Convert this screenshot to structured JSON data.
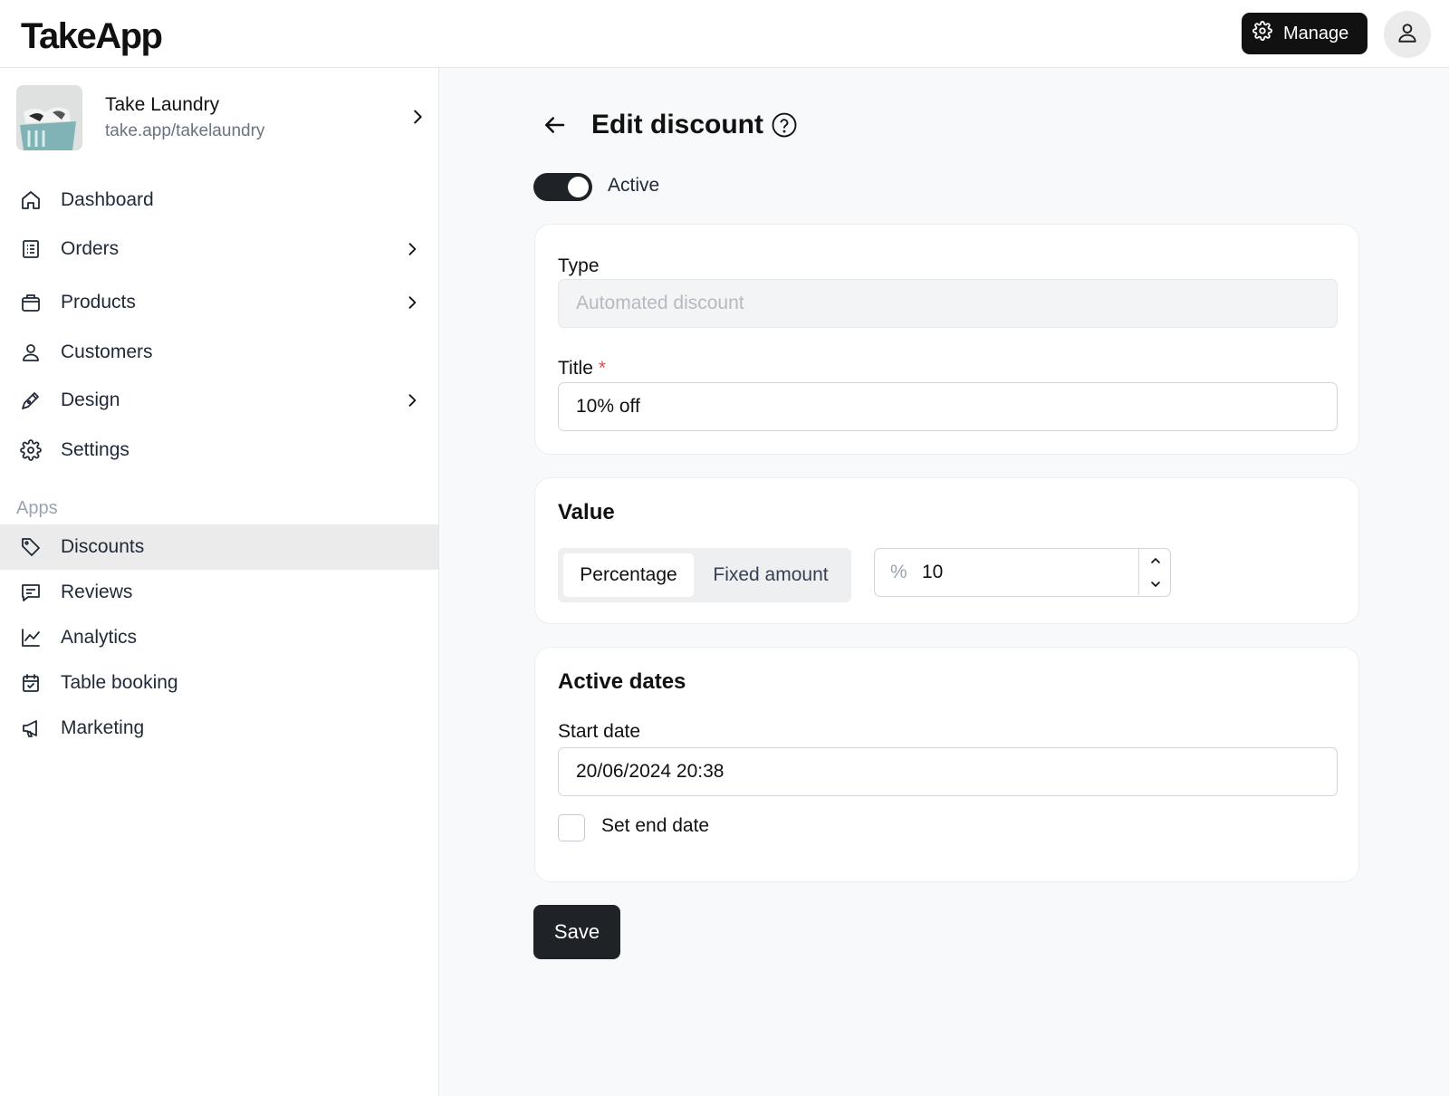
{
  "header": {
    "logo": "TakeApp",
    "manage_label": "Manage"
  },
  "store": {
    "name": "Take Laundry",
    "url": "take.app/takelaundry"
  },
  "sidebar": {
    "items": [
      {
        "label": "Dashboard"
      },
      {
        "label": "Orders"
      },
      {
        "label": "Products"
      },
      {
        "label": "Customers"
      },
      {
        "label": "Design"
      },
      {
        "label": "Settings"
      }
    ],
    "apps_heading": "Apps",
    "apps": [
      {
        "label": "Discounts"
      },
      {
        "label": "Reviews"
      },
      {
        "label": "Analytics"
      },
      {
        "label": "Table booking"
      },
      {
        "label": "Marketing"
      }
    ]
  },
  "page": {
    "title": "Edit discount",
    "active_label": "Active",
    "active": true
  },
  "details": {
    "type_label": "Type",
    "type_value": "Automated discount",
    "title_label": "Title",
    "required_mark": "*",
    "title_value": "10% off"
  },
  "value_card": {
    "heading": "Value",
    "options": [
      "Percentage",
      "Fixed amount"
    ],
    "selected": "Percentage",
    "prefix": "%",
    "amount": "10"
  },
  "dates": {
    "heading": "Active dates",
    "start_label": "Start date",
    "start_value": "20/06/2024 20:38",
    "end_label": "Set end date",
    "end_checked": false
  },
  "actions": {
    "save_label": "Save"
  }
}
